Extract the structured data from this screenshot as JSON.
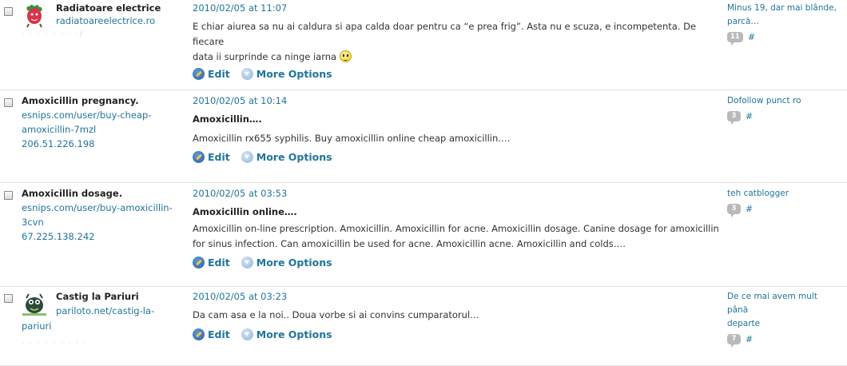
{
  "actions": {
    "edit_label": "Edit",
    "more_label": "More Options"
  },
  "comments": [
    {
      "author_name": "Radiatoare electrice",
      "author_url": "radiatoareelectrice.ro",
      "faded_text": "· · · ·  · · · ·/",
      "date": "2010/02/05 at 11:07",
      "body_line1": "E chiar aiurea sa nu ai caldura si apa calda doar pentru ca “e prea frig”. Asta nu e scuza, e incompetenta. De fiecare",
      "body_line2": "data ii surprinde ca ninge iarna",
      "post_title_line1": "Minus 19, dar mai blânde,",
      "post_title_line2": "parcă…",
      "count": "11",
      "hash": "#"
    },
    {
      "author_name": "Amoxicillin pregnancy.",
      "author_url_line1": "esnips.com/user/buy-cheap-",
      "author_url_line2": "amoxicillin-7mzl",
      "ip": "206.51.226.198",
      "date": "2010/02/05 at 10:14",
      "subject": "Amoxicillin….",
      "body": "Amoxicillin rx655 syphilis. Buy amoxicillin online cheap amoxicillin….",
      "post_title": "Dofollow punct ro",
      "count": "3",
      "hash": "#"
    },
    {
      "author_name": "Amoxicillin dosage.",
      "author_url_line1": "esnips.com/user/buy-amoxicillin-",
      "author_url_line2": "3cvn",
      "ip": "67.225.138.242",
      "date": "2010/02/05 at 03:53",
      "subject": "Amoxicillin online….",
      "body_line1": "Amoxicillin on-line prescription. Amoxicillin. Amoxicillin for acne. Amoxicillin dosage. Canine dosage for amoxicillin",
      "body_line2": "for sinus infection. Can amoxicillin be used for acne. Amoxicillin acne. Amoxicillin and colds….",
      "post_title": "teh catblogger",
      "count": "3",
      "hash": "#"
    },
    {
      "author_name": "Castig la Pariuri",
      "author_url_line1": "pariloto.net/castig-la-",
      "author_url_line2": "pariuri",
      "faded_text": "· · ·  · · · · · ·",
      "date": "2010/02/05 at 03:23",
      "body": "Da cam asa e la noi.. Doua vorbe si ai convins cumparatorul…",
      "post_title_line1": "De ce mai avem mult până",
      "post_title_line2": "departe",
      "count": "7",
      "hash": "#"
    }
  ]
}
